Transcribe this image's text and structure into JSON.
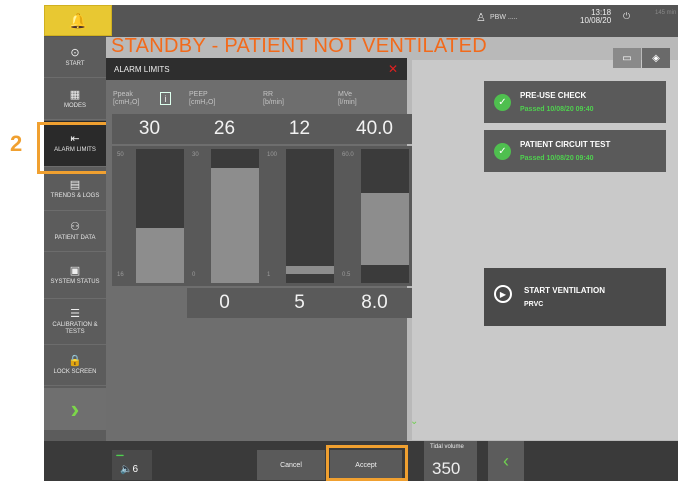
{
  "window": {
    "title": "STANDBY - PATIENT NOT VENTILATED",
    "pbw": "PBW .....",
    "time": "13:18",
    "date": "10/08/20",
    "battery_text": "145 min"
  },
  "step_marker": "2",
  "sidebar": {
    "items": [
      {
        "label": "START",
        "icon": "⊙"
      },
      {
        "label": "MODES",
        "icon": "▦"
      },
      {
        "label": "ALARM LIMITS",
        "icon": "⇤"
      },
      {
        "label": "TRENDS & LOGS",
        "icon": "▤"
      },
      {
        "label": "PATIENT DATA",
        "icon": "⚇"
      },
      {
        "label": "SYSTEM STATUS",
        "icon": "▣"
      },
      {
        "label": "CALIBRATION & TESTS",
        "icon": "☰"
      },
      {
        "label": "LOCK SCREEN",
        "icon": "🔒"
      }
    ],
    "next_icon": "›"
  },
  "dialog": {
    "title": "ALARM LIMITS",
    "close": "✕",
    "params": [
      {
        "name": "Ppeak",
        "unit": "[cmH₂O]",
        "high": "30",
        "low": "",
        "scale_max": "50",
        "scale_min": "16"
      },
      {
        "name": "PEEP",
        "unit": "[cmH₂O]",
        "high": "26",
        "low": "0",
        "scale_max": "30",
        "scale_min": "0"
      },
      {
        "name": "RR",
        "unit": "[b/min]",
        "high": "12",
        "low": "5",
        "scale_max": "100",
        "scale_min": "1"
      },
      {
        "name": "MVe",
        "unit": "[l/min]",
        "high": "40.0",
        "low": "8.0",
        "scale_max": "60.0",
        "scale_min": "0.5"
      }
    ],
    "info_icon": "i"
  },
  "cards": [
    {
      "title": "PRE-USE CHECK",
      "sub": "Passed 10/08/20 09:40"
    },
    {
      "title": "PATIENT CIRCUIT TEST",
      "sub": "Passed 10/08/20 09:40"
    },
    {
      "title": "START VENTILATION",
      "sub": "PRVC"
    }
  ],
  "bottom": {
    "volume": "6",
    "cancel": "Cancel",
    "accept": "Accept",
    "tidal_label": "Tidal volume",
    "tidal_value": "350",
    "back_icon": "‹"
  },
  "colors": {
    "title": "#f26a1b",
    "highlight": "#f0a030",
    "ok_green": "#4fbf4f",
    "close_red": "#e02020"
  }
}
